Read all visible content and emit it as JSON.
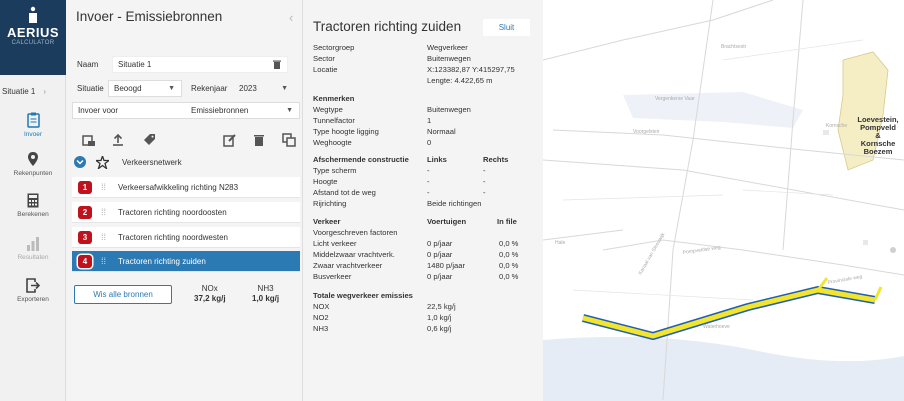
{
  "brand": {
    "name": "AERIUS",
    "sub": "CALCULATOR"
  },
  "rail": {
    "situation": "Situatie 1",
    "nav": [
      {
        "label": "Invoer",
        "icon": "clipboard-icon"
      },
      {
        "label": "Rekenpunten",
        "icon": "map-marker-icon"
      },
      {
        "label": "Berekenen",
        "icon": "calculator-icon"
      },
      {
        "label": "Resultaten",
        "icon": "results-icon"
      },
      {
        "label": "Exporteren",
        "icon": "export-icon"
      }
    ]
  },
  "panel": {
    "title": "Invoer - Emissiebronnen",
    "naam_label": "Naam",
    "naam_value": "Situatie 1",
    "situatie_label": "Situatie",
    "situatie_value": "Beoogd",
    "rekenjaar_label": "Rekenjaar",
    "rekenjaar_value": "2023",
    "invoer_label": "Invoer voor",
    "invoer_value": "Emissiebronnen",
    "group": "Verkeersnetwerk",
    "sources": [
      {
        "num": "1",
        "name": "Verkeersafwikkeling richting N283"
      },
      {
        "num": "2",
        "name": "Tractoren richting noordoosten"
      },
      {
        "num": "3",
        "name": "Tractoren richting noordwesten"
      },
      {
        "num": "4",
        "name": "Tractoren richting zuiden"
      }
    ],
    "wis": "Wis alle bronnen",
    "nox_label": "NOx",
    "nox_value": "37,2 kg/j",
    "nh3_label": "NH3",
    "nh3_value": "1,0 kg/j"
  },
  "detail": {
    "title": "Tractoren richting zuiden",
    "close": "Sluit",
    "sectorgroep_k": "Sectorgroep",
    "sectorgroep_v": "Wegverkeer",
    "sector_k": "Sector",
    "sector_v": "Buitenwegen",
    "locatie_k": "Locatie",
    "locatie_v": "X:123382,87 Y:415297,75",
    "lengte_v": "Lengte: 4.422,65 m",
    "kenmerken": "Kenmerken",
    "wegtype_k": "Wegtype",
    "wegtype_v": "Buitenwegen",
    "tunnel_k": "Tunnelfactor",
    "tunnel_v": "1",
    "hoogte_k": "Type hoogte ligging",
    "hoogte_v": "Normaal",
    "weghoogte_k": "Weghoogte",
    "weghoogte_v": "0",
    "afsch": "Afschermende constructie",
    "links": "Links",
    "rechts": "Rechts",
    "scherm_k": "Type scherm",
    "scherm_l": "-",
    "scherm_r": "-",
    "hoogte2_k": "Hoogte",
    "hoogte2_l": "-",
    "hoogte2_r": "-",
    "afstand_k": "Afstand tot de weg",
    "afstand_l": "-",
    "afstand_r": "-",
    "rijrichting_k": "Rijrichting",
    "rijrichting_v": "Beide richtingen",
    "verkeer": "Verkeer",
    "voertuigen": "Voertuigen",
    "infile": "In file",
    "voorgeschreven": "Voorgeschreven factoren",
    "rows": [
      {
        "k": "Licht verkeer",
        "v": "0 p/jaar",
        "f": "0,0 %"
      },
      {
        "k": "Middelzwaar vrachtverk.",
        "v": "0 p/jaar",
        "f": "0,0 %"
      },
      {
        "k": "Zwaar vrachtverkeer",
        "v": "1480 p/jaar",
        "f": "0,0 %"
      },
      {
        "k": "Busverkeer",
        "v": "0 p/jaar",
        "f": "0,0 %"
      }
    ],
    "totaal": "Totale wegverkeer emissies",
    "em": [
      {
        "k": "NOX",
        "v": "22,5 kg/j"
      },
      {
        "k": "NO2",
        "v": "1,0 kg/j"
      },
      {
        "k": "NH3",
        "v": "0,6 kg/j"
      }
    ]
  },
  "map": {
    "poi": [
      "Loevestein,",
      "Pompveld",
      "&",
      "Kornsche",
      "Boezem"
    ],
    "labels": [
      "Brachtsestr",
      "Vergenkerse Vaar",
      "Voorgelsteir",
      "Kornsche",
      "Pompveldse weg",
      "Hale",
      "Kanaal van Sleeuwijk",
      "Provinciale weg",
      "Waterhoeve"
    ],
    "road_color": "#f2e52b",
    "outline_color": "#1f5fb4"
  }
}
